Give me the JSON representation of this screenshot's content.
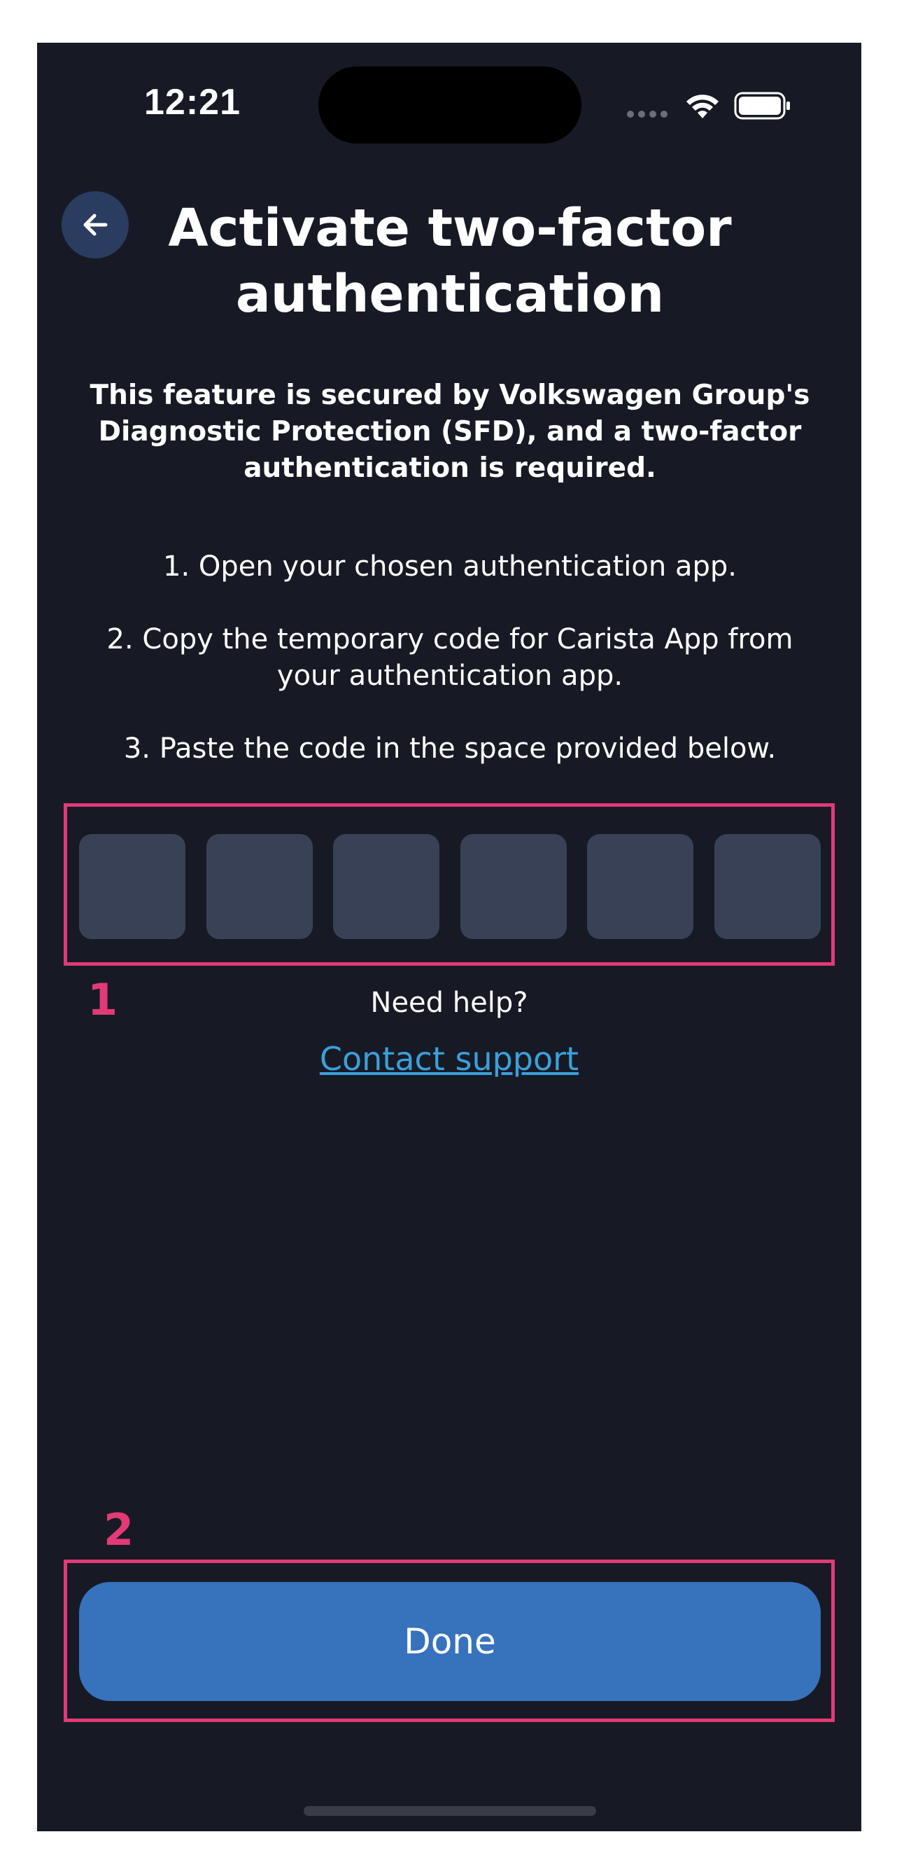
{
  "status_bar": {
    "time": "12:21"
  },
  "header": {
    "back_icon": "arrow-left-icon",
    "title": "Activate two-factor authentication"
  },
  "main": {
    "secure_note": "This feature is secured by Volkswagen Group's Diagnostic Protection (SFD), and a two-factor authentication is required.",
    "steps": [
      "1. Open your chosen authentication app.",
      "2. Copy the temporary code for Carista App from your authentication app.",
      "3. Paste the code in the space provided below."
    ],
    "code_digits": [
      "",
      "",
      "",
      "",
      "",
      ""
    ],
    "help_text": "Need help?",
    "contact_link": "Contact support"
  },
  "annotations": {
    "marker_1": "1",
    "marker_2": "2"
  },
  "footer": {
    "done_label": "Done"
  },
  "colors": {
    "background": "#171a24",
    "accent": "#3772bc",
    "link": "#3aa0db",
    "highlight": "#e23a76",
    "code_box": "#394156"
  }
}
